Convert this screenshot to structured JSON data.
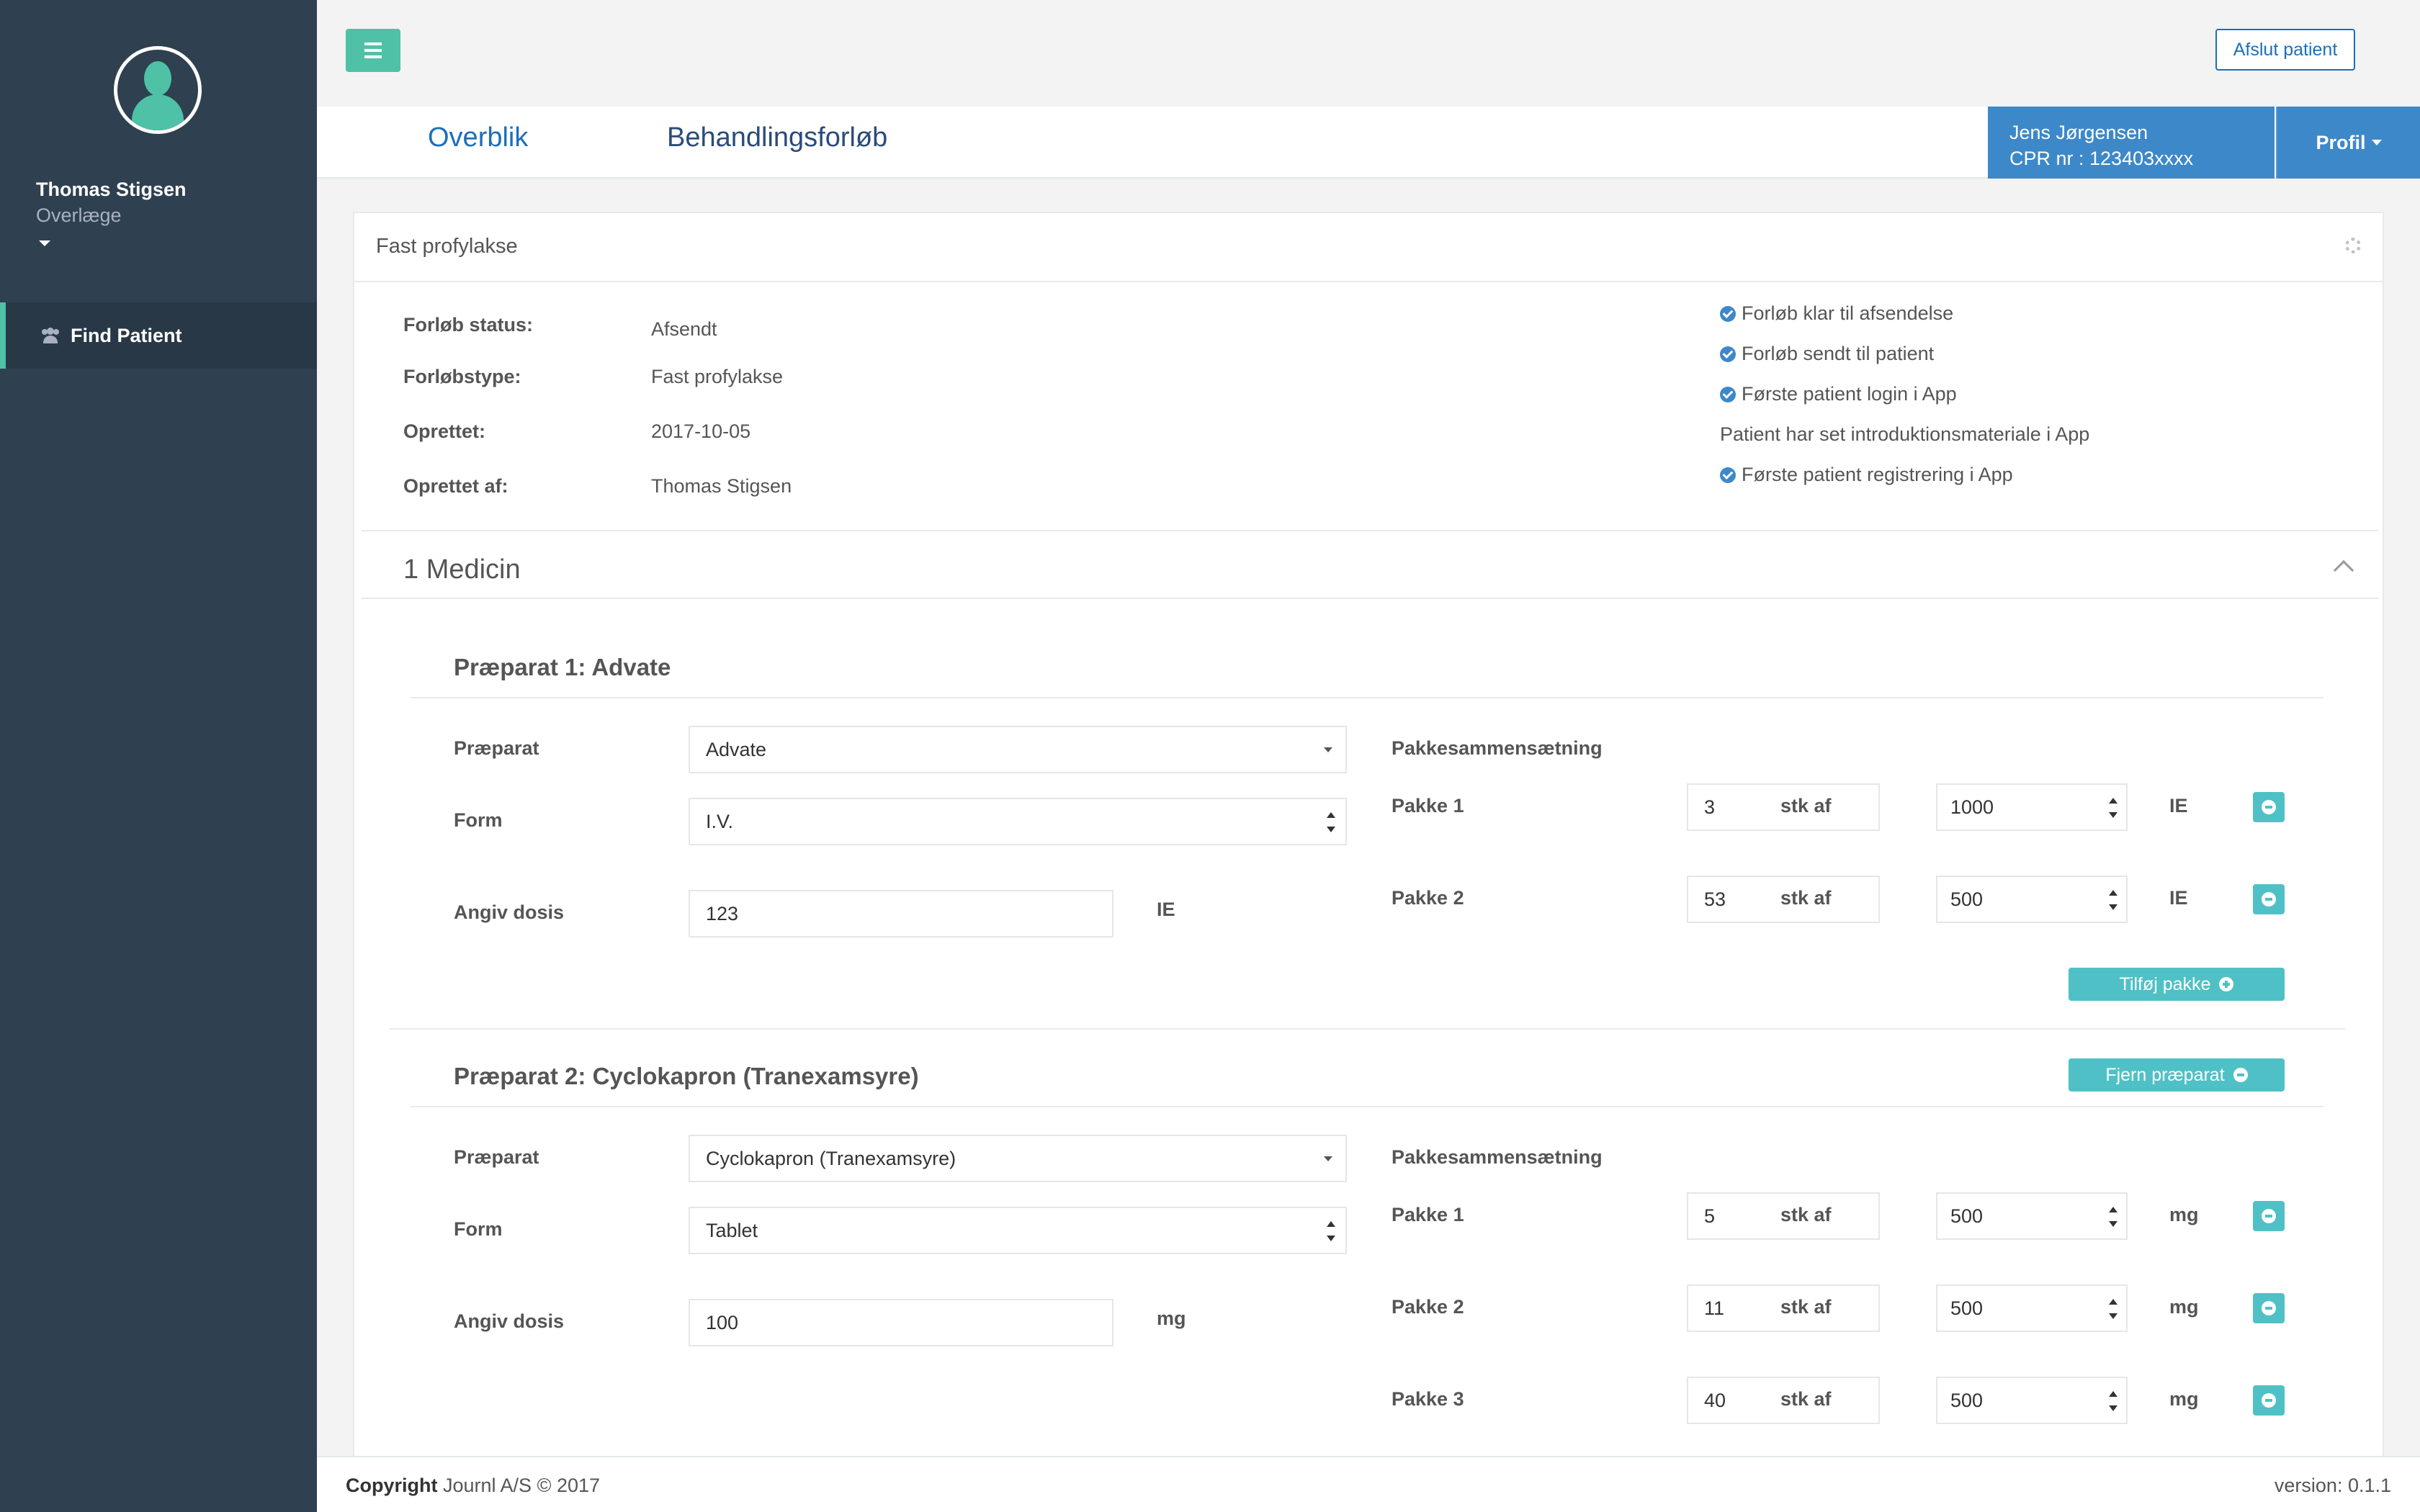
{
  "sidebar": {
    "user_name": "Thomas Stigsen",
    "user_role": "Overlæge",
    "nav": [
      {
        "label": "Find Patient",
        "icon": "users-icon"
      }
    ]
  },
  "header": {
    "afslut_label": "Afslut patient",
    "tabs": [
      {
        "label": "Overblik"
      },
      {
        "label": "Behandlingsforløb"
      }
    ],
    "patient_name": "Jens Jørgensen",
    "patient_cpr": "CPR nr : 123403xxxx",
    "profil_label": "Profil"
  },
  "panel": {
    "title": "Fast profylakse",
    "info": [
      {
        "label": "Forløb status:",
        "value": "Afsendt"
      },
      {
        "label": "Forløbstype:",
        "value": "Fast profylakse"
      },
      {
        "label": "Oprettet:",
        "value": "2017-10-05"
      },
      {
        "label": "Oprettet af:",
        "value": "Thomas Stigsen"
      }
    ],
    "checklist": [
      {
        "text": "Forløb klar til afsendelse",
        "checked": true
      },
      {
        "text": "Forløb sendt til patient",
        "checked": true
      },
      {
        "text": "Første patient login i App",
        "checked": true
      },
      {
        "text": "Patient har set introduktionsmateriale i App",
        "checked": false
      },
      {
        "text": "Første patient registrering i App",
        "checked": true
      }
    ],
    "section_title": "1 Medicin"
  },
  "labels": {
    "praeparat": "Præparat",
    "form": "Form",
    "dosis": "Angiv dosis",
    "pakke_header": "Pakkesammensætning",
    "stk_af": "stk af",
    "tilfoej_pakke": "Tilføj pakke",
    "fjern_praeparat": "Fjern præparat"
  },
  "preparations": [
    {
      "title": "Præparat 1: Advate",
      "praeparat": "Advate",
      "form": "I.V.",
      "dosis": "123",
      "dosis_unit": "IE",
      "packages": [
        {
          "label": "Pakke 1",
          "count": "3",
          "size": "1000",
          "unit": "IE"
        },
        {
          "label": "Pakke 2",
          "count": "53",
          "size": "500",
          "unit": "IE"
        }
      ]
    },
    {
      "title": "Præparat 2: Cyclokapron (Tranexamsyre)",
      "praeparat": "Cyclokapron (Tranexamsyre)",
      "form": "Tablet",
      "dosis": "100",
      "dosis_unit": "mg",
      "packages": [
        {
          "label": "Pakke 1",
          "count": "5",
          "size": "500",
          "unit": "mg"
        },
        {
          "label": "Pakke 2",
          "count": "11",
          "size": "500",
          "unit": "mg"
        },
        {
          "label": "Pakke 3",
          "count": "40",
          "size": "500",
          "unit": "mg"
        }
      ]
    }
  ],
  "footer": {
    "copyright_bold": "Copyright",
    "copyright_rest": " Journl A/S © 2017",
    "version": "version: 0.1.1"
  },
  "colors": {
    "accent_teal": "#4fc1a6",
    "primary_blue": "#3d88c9",
    "sidebar_bg": "#2f4050"
  }
}
